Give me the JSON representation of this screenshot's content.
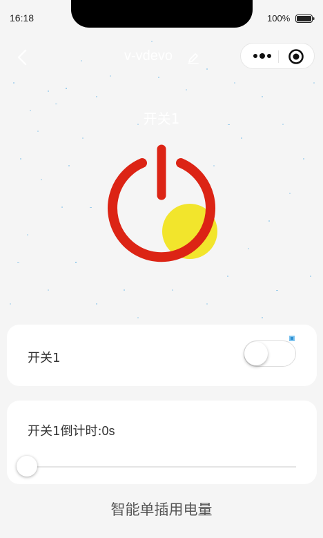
{
  "status_bar": {
    "time": "16:18",
    "battery": "100%"
  },
  "nav": {
    "title": "v-vdevo"
  },
  "hero": {
    "label": "开关1"
  },
  "switch_card": {
    "label": "开关1",
    "on": false
  },
  "timer_card": {
    "label_prefix": "开关1倒计时:",
    "value": "0s",
    "progress": 0
  },
  "footer": {
    "link": "智能单插用电量"
  },
  "colors": {
    "power_red": "#dc2415",
    "power_yellow": "#f2e52c",
    "background": "#f5f5f5",
    "card": "#ffffff"
  }
}
